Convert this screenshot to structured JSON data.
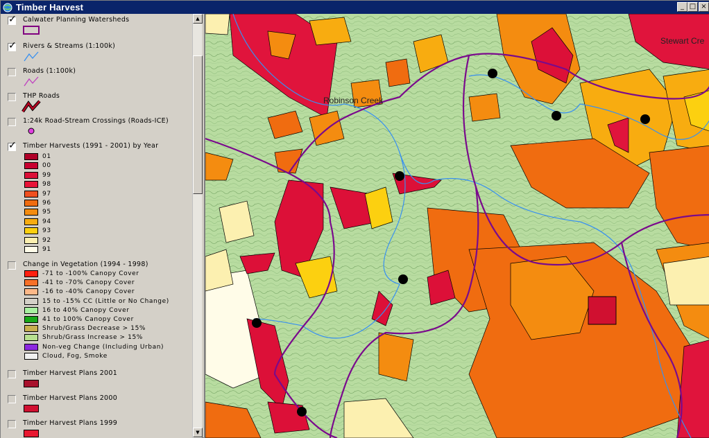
{
  "window": {
    "title": "Timber Harvest",
    "min_glyph": "_",
    "max_glyph": "□",
    "close_glyph": "×"
  },
  "toc": {
    "layers": [
      {
        "name": "Calwater Planning Watersheds",
        "checked": true
      },
      {
        "name": "Rivers & Streams (1:100k)",
        "checked": true
      },
      {
        "name": "Roads (1:100k)",
        "checked": false
      },
      {
        "name": "THP Roads",
        "checked": false
      },
      {
        "name": "1:24k Road-Stream Crossings (Roads-ICE)",
        "checked": false
      },
      {
        "name": "Timber Harvests (1991 - 2001) by Year",
        "checked": true
      },
      {
        "name": "Change in Vegetation (1994 - 1998)",
        "checked": false
      },
      {
        "name": "Timber Harvest Plans 2001",
        "checked": false
      },
      {
        "name": "Timber Harvest Plans 2000",
        "checked": false
      },
      {
        "name": "Timber Harvest Plans 1999",
        "checked": false
      }
    ],
    "harvest_years": [
      {
        "label": "01",
        "color": "#b00028"
      },
      {
        "label": "00",
        "color": "#c80030"
      },
      {
        "label": "99",
        "color": "#dc1038"
      },
      {
        "label": "98",
        "color": "#e81438"
      },
      {
        "label": "97",
        "color": "#f05020"
      },
      {
        "label": "96",
        "color": "#f06c10"
      },
      {
        "label": "95",
        "color": "#f48c10"
      },
      {
        "label": "94",
        "color": "#f8ac10"
      },
      {
        "label": "93",
        "color": "#fcd010"
      },
      {
        "label": "92",
        "color": "#fcf0b0"
      },
      {
        "label": "91",
        "color": "#fffce8"
      }
    ],
    "vegetation_change": [
      {
        "label": "-71 to -100% Canopy Cover",
        "color": "#ff2010"
      },
      {
        "label": "-41 to -70% Canopy Cover",
        "color": "#f87028"
      },
      {
        "label": "-16 to -40% Canopy Cover",
        "color": "#fcb888"
      },
      {
        "label": "15 to -15% CC (Little or No Change)",
        "color": "#d4d0c8"
      },
      {
        "label": "16 to 40% Canopy Cover",
        "color": "#a8f0a0"
      },
      {
        "label": "41 to 100% Canopy Cover",
        "color": "#18a818"
      },
      {
        "label": "Shrub/Grass Decrease > 15%",
        "color": "#c8b050"
      },
      {
        "label": "Shrub/Grass Increase > 15%",
        "color": "#b8e090"
      },
      {
        "label": "Non-veg Change (Including Urban)",
        "color": "#8c28e0"
      },
      {
        "label": "Cloud, Fog, Smoke",
        "color": "#f0f0f0"
      }
    ],
    "thp_swatches": {
      "y2001": "#a8102c",
      "y2000": "#d01030",
      "y1999": "#e81830"
    }
  },
  "map": {
    "labels": {
      "creek": "Robinson Creek",
      "corner": "Stewart Cre"
    }
  }
}
